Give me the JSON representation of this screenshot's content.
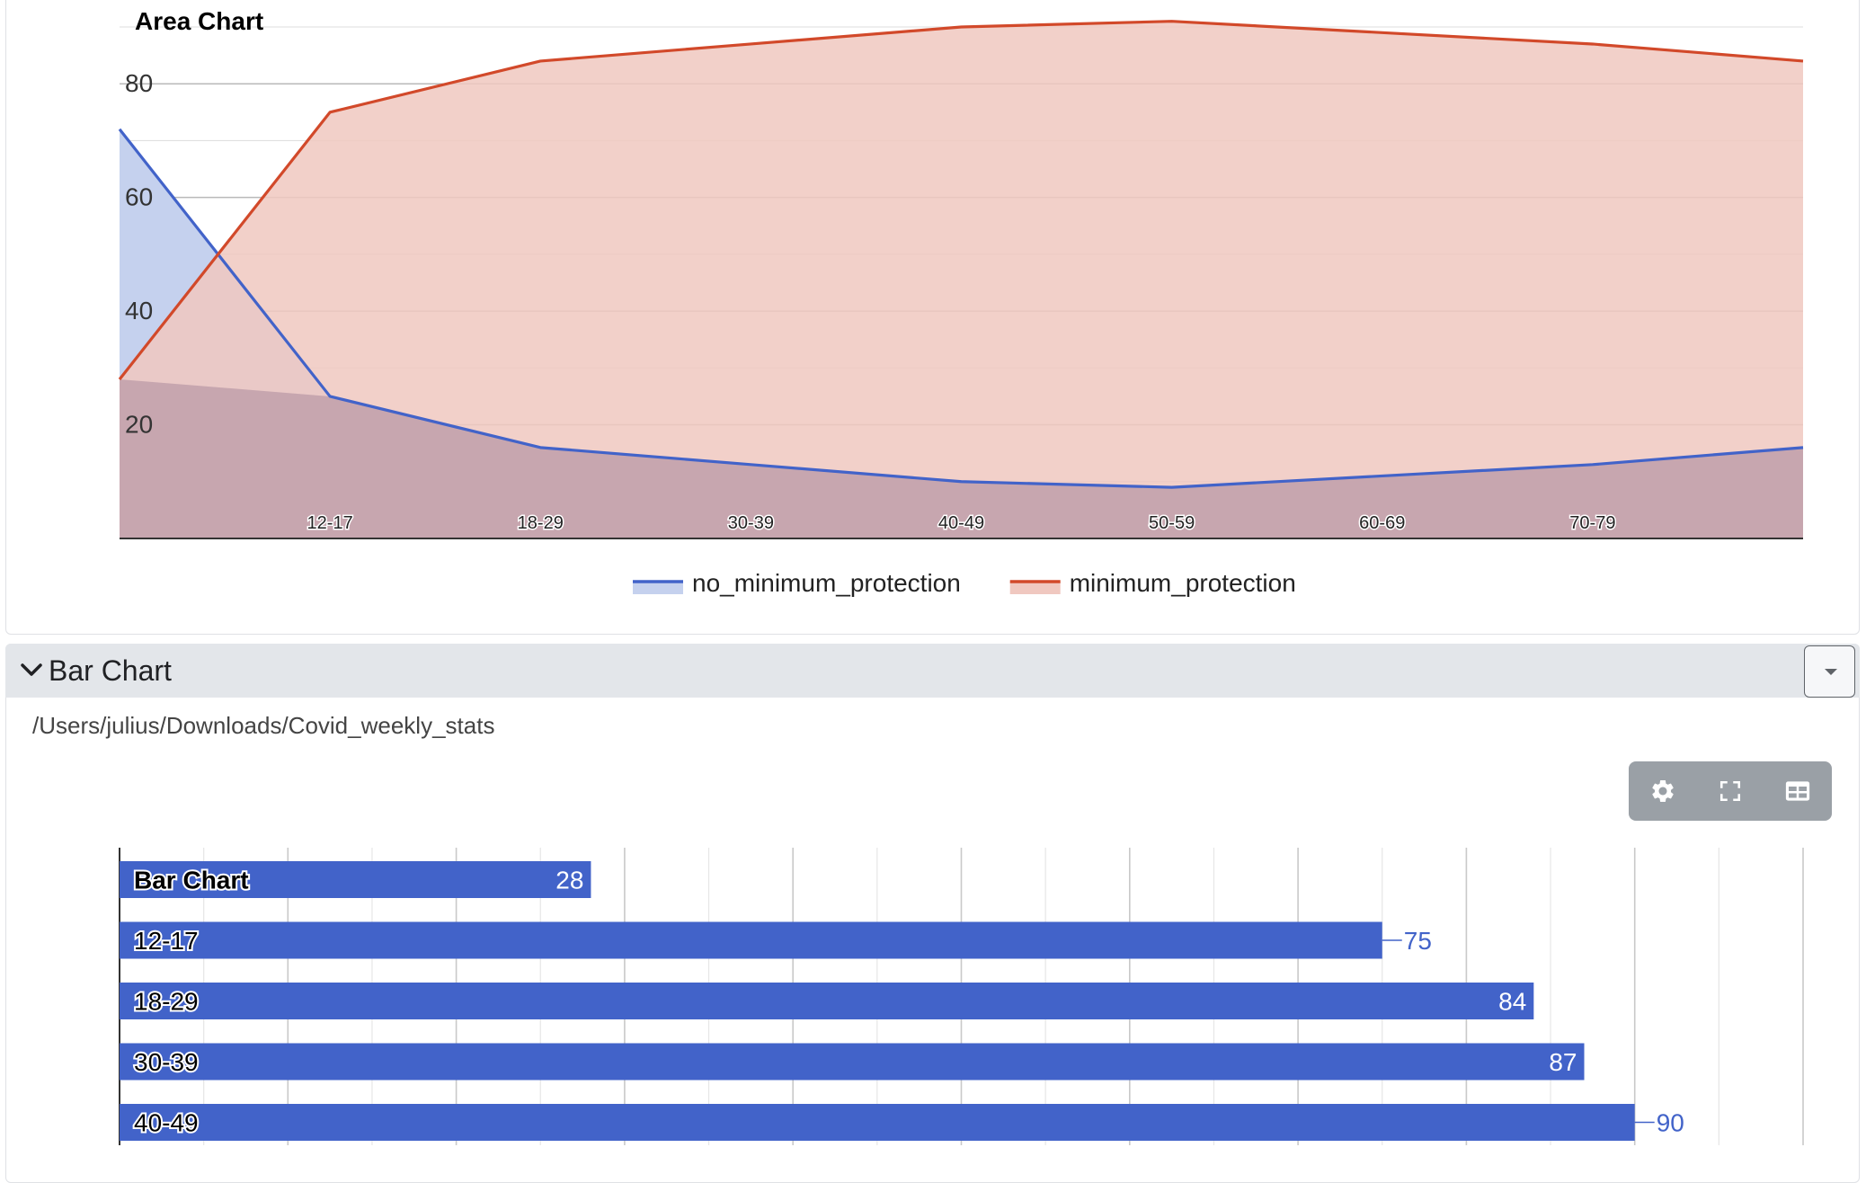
{
  "area_panel": {
    "chart_data": {
      "type": "area",
      "title": "Area Chart",
      "categories": [
        "",
        "12-17",
        "18-29",
        "30-39",
        "40-49",
        "50-59",
        "60-69",
        "70-79",
        ""
      ],
      "yticks": [
        "20",
        "40",
        "60",
        "80"
      ],
      "ylim": [
        0,
        90
      ],
      "grid": true,
      "legend_position": "bottom",
      "series": [
        {
          "name": "no_minimum_protection",
          "color": "#4263c9",
          "fill": "#c5d1ee",
          "values": [
            72,
            25,
            16,
            13,
            10,
            9,
            11,
            13,
            16
          ]
        },
        {
          "name": "minimum_protection",
          "color": "#d2492a",
          "fill": "#f0c8c0",
          "values": [
            28,
            75,
            84,
            87,
            90,
            91,
            89,
            87,
            84
          ]
        }
      ]
    }
  },
  "bar_section": {
    "title": "Bar Chart",
    "file_path": "/Users/julius/Downloads/Covid_weekly_stats",
    "toolbar": {
      "settings_icon": "gear-icon",
      "fullscreen_icon": "fullscreen-icon",
      "table_icon": "table-icon"
    }
  },
  "bar_panel": {
    "chart_data": {
      "type": "bar",
      "orientation": "horizontal",
      "categories": [
        "Bar Chart",
        "12-17",
        "18-29",
        "30-39",
        "40-49"
      ],
      "values": [
        28,
        75,
        84,
        87,
        90
      ],
      "value_labels": [
        "28",
        "75",
        "84",
        "87",
        "90"
      ],
      "xlim": [
        0,
        100
      ],
      "bar_color": "#4263c9",
      "grid": true
    }
  }
}
